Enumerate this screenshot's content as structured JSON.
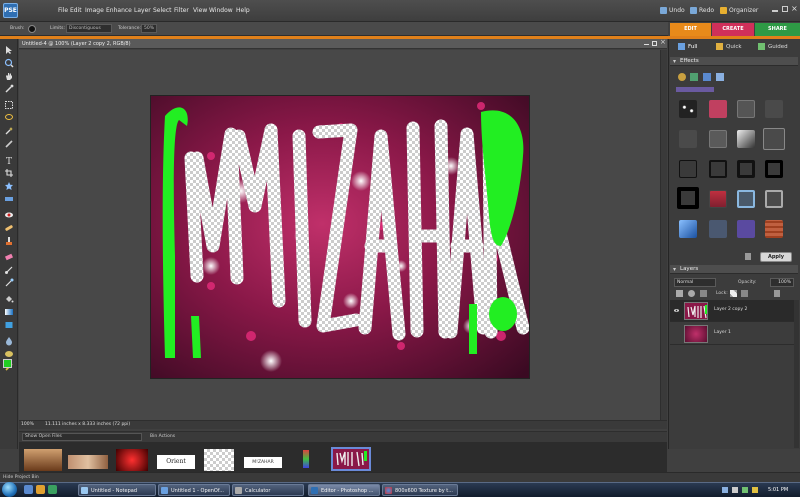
{
  "app": {
    "logo_text": "PSE",
    "menu": [
      "File",
      "Edit",
      "Image",
      "Enhance",
      "Layer",
      "Select",
      "Filter",
      "View",
      "Window",
      "Help"
    ],
    "undo_label": "Undo",
    "redo_label": "Redo",
    "organizer_label": "Organizer"
  },
  "mode_tabs": {
    "edit": "EDIT",
    "create": "CREATE",
    "share": "SHARE"
  },
  "options_bar": {
    "brush_label": "Brush:",
    "limits_label": "Limits:",
    "limits_value": "Discontiguous",
    "tolerance_label": "Tolerance:",
    "tolerance_value": "50%"
  },
  "document": {
    "title": "Untitled-4 @ 100% (Layer 2 copy 2, RGB/8)",
    "zoom": "100%",
    "size_info": "11.111 inches x 8.333 inches (72 ppi)",
    "artwork_text": "MIZAHAR!"
  },
  "edit_subtabs": {
    "full": "Full",
    "quick": "Quick",
    "guided": "Guided"
  },
  "effects": {
    "title": "Effects",
    "apply_label": "Apply"
  },
  "layers": {
    "title": "Layers",
    "blend_mode": "Normal",
    "opacity_label": "Opacity:",
    "opacity_value": "100%",
    "lock_label": "Lock:",
    "items": [
      {
        "name": "Layer 2 copy 2",
        "selected": true
      },
      {
        "name": "Layer 1",
        "selected": false
      }
    ]
  },
  "project_bin": {
    "dropdown": "Show Open Files",
    "actions_label": "Bin Actions",
    "hide_label": "Hide Project Bin",
    "thumb_texts": [
      "Orient",
      "M!ZAHAR"
    ]
  },
  "taskbar": {
    "buttons": [
      "Untitled - Notepad",
      "Untitled 1 - OpenOf...",
      "Calculator",
      "Editor - Photoshop ...",
      "800x600 Texture by t..."
    ],
    "clock": "5:01 PM"
  },
  "colors": {
    "accent_orange": "#e0801a",
    "create_pink": "#d0305a",
    "share_green": "#2e9a45",
    "foreground_swatch": "#22cc22"
  }
}
